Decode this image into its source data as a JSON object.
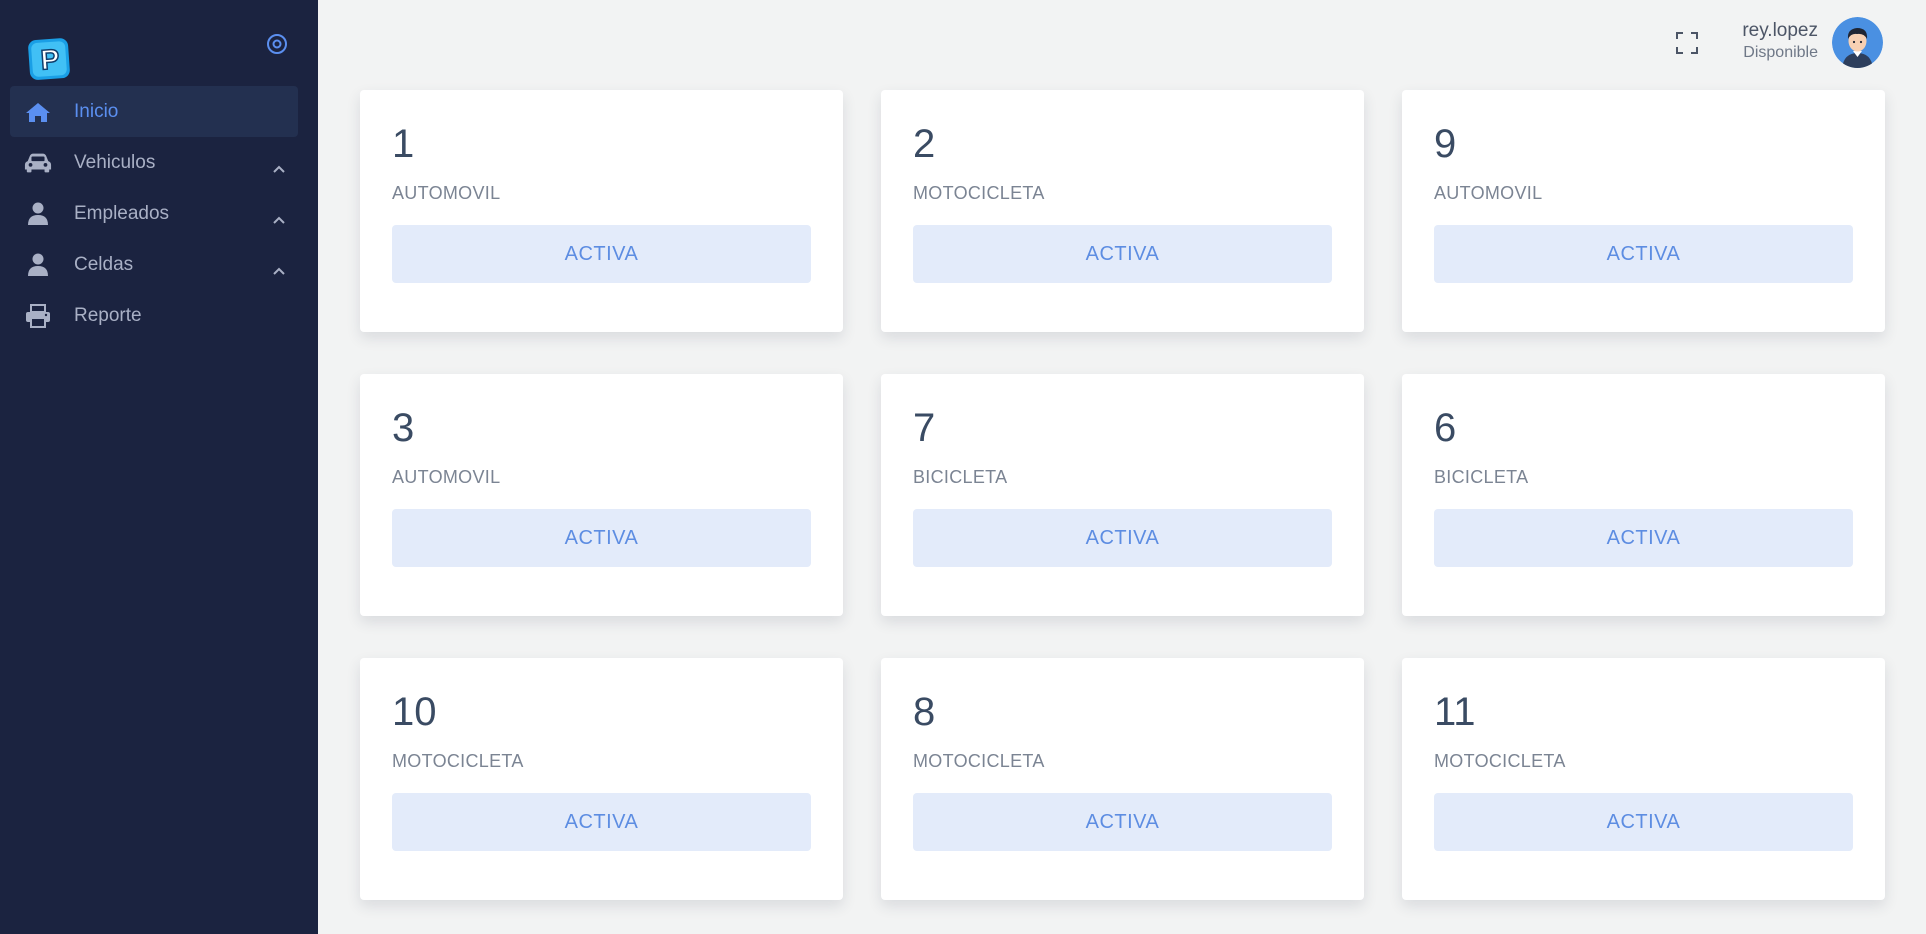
{
  "sidebar": {
    "logo_text": "P",
    "items": [
      {
        "label": "Inicio",
        "icon": "home-icon",
        "active": true,
        "expandable": false
      },
      {
        "label": "Vehiculos",
        "icon": "car-icon",
        "active": false,
        "expandable": true
      },
      {
        "label": "Empleados",
        "icon": "user-icon",
        "active": false,
        "expandable": true
      },
      {
        "label": "Celdas",
        "icon": "user-icon",
        "active": false,
        "expandable": true
      },
      {
        "label": "Reporte",
        "icon": "printer-icon",
        "active": false,
        "expandable": false
      }
    ]
  },
  "header": {
    "username": "rey.lopez",
    "status": "Disponible"
  },
  "cards": [
    {
      "number": "1",
      "type": "AUTOMOVIL",
      "button": "ACTIVA"
    },
    {
      "number": "2",
      "type": "MOTOCICLETA",
      "button": "ACTIVA"
    },
    {
      "number": "9",
      "type": "AUTOMOVIL",
      "button": "ACTIVA"
    },
    {
      "number": "3",
      "type": "AUTOMOVIL",
      "button": "ACTIVA"
    },
    {
      "number": "7",
      "type": "BICICLETA",
      "button": "ACTIVA"
    },
    {
      "number": "6",
      "type": "BICICLETA",
      "button": "ACTIVA"
    },
    {
      "number": "10",
      "type": "MOTOCICLETA",
      "button": "ACTIVA"
    },
    {
      "number": "8",
      "type": "MOTOCICLETA",
      "button": "ACTIVA"
    },
    {
      "number": "11",
      "type": "MOTOCICLETA",
      "button": "ACTIVA"
    }
  ],
  "colors": {
    "sidebar_bg": "#1b2340",
    "accent": "#5b8ff0",
    "page_bg": "#f2f3f3",
    "button_bg": "#e3ebfa"
  }
}
